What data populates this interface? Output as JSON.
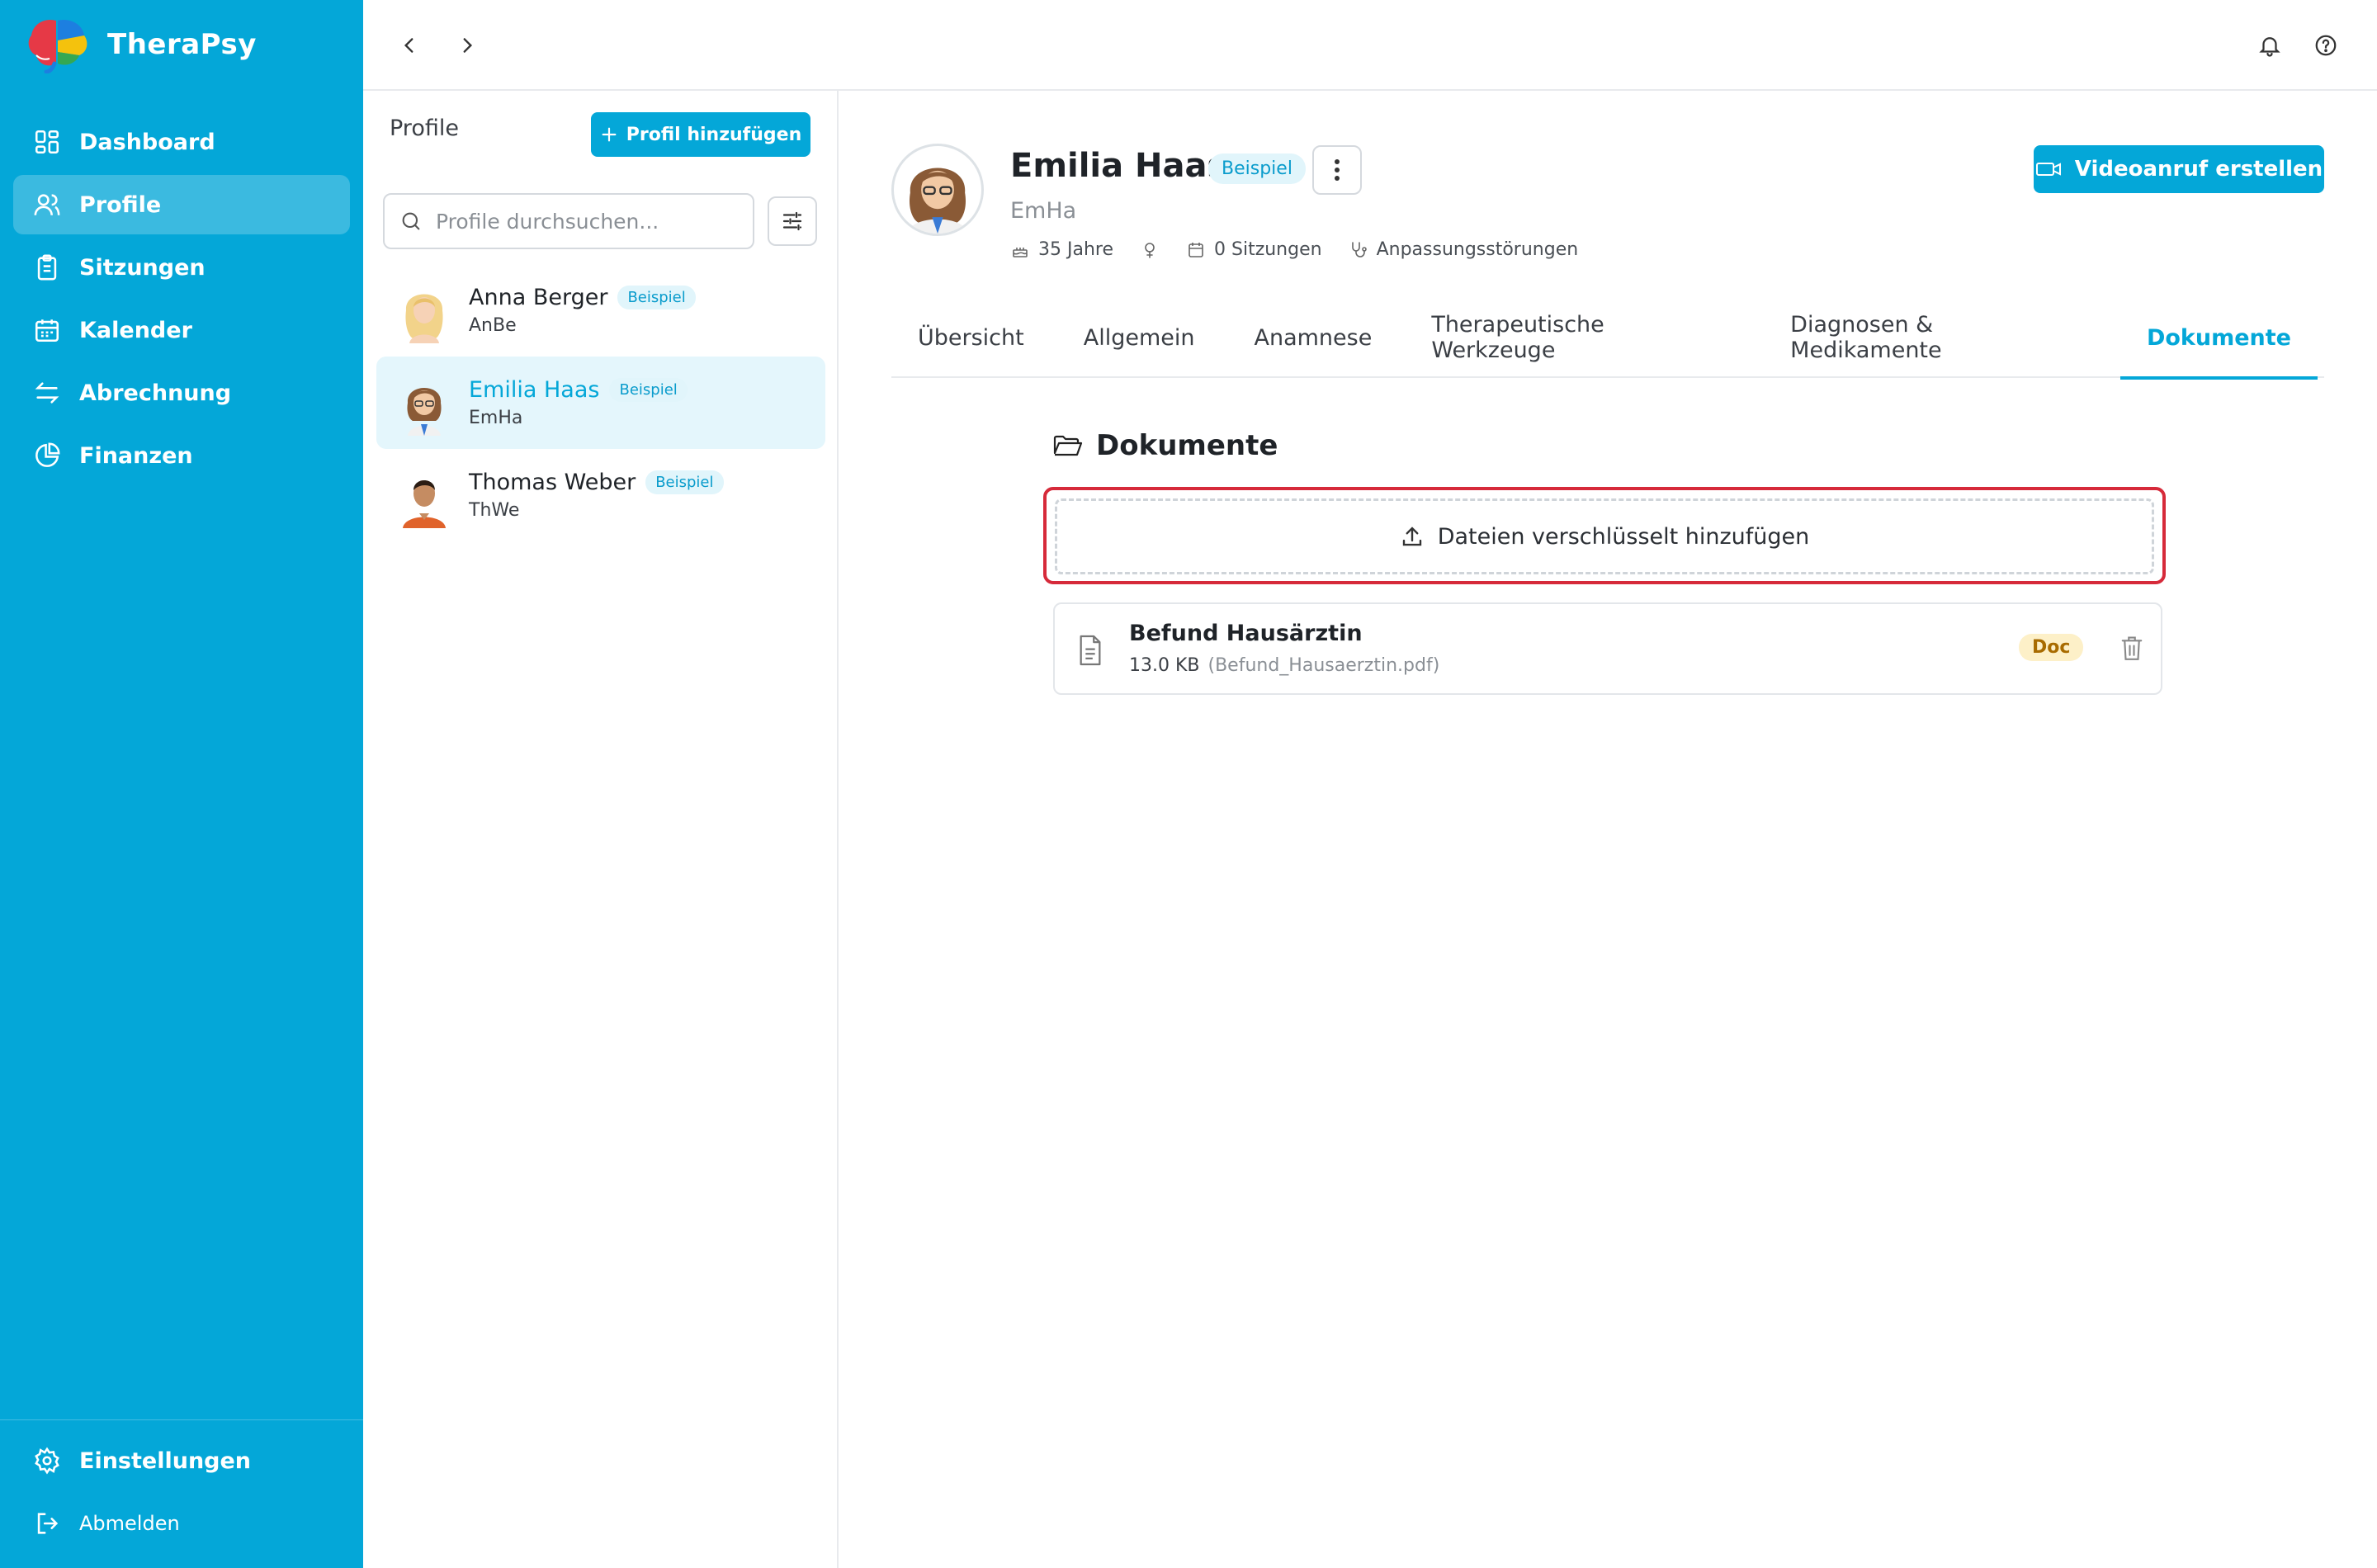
{
  "app": {
    "name": "TheraPsy"
  },
  "sidebar": {
    "items": [
      {
        "label": "Dashboard",
        "icon": "dashboard-icon"
      },
      {
        "label": "Profile",
        "icon": "users-icon",
        "active": true
      },
      {
        "label": "Sitzungen",
        "icon": "clipboard-icon"
      },
      {
        "label": "Kalender",
        "icon": "calendar-icon"
      },
      {
        "label": "Abrechnung",
        "icon": "arrows-exchange-icon"
      },
      {
        "label": "Finanzen",
        "icon": "pie-chart-icon"
      }
    ],
    "settings_label": "Einstellungen",
    "logout_label": "Abmelden"
  },
  "profiles": {
    "title": "Profile",
    "add_label": "Profil hinzufügen",
    "search_placeholder": "Profile durchsuchen...",
    "items": [
      {
        "name": "Anna Berger",
        "short": "AnBe",
        "badge": "Beispiel"
      },
      {
        "name": "Emilia Haas",
        "short": "EmHa",
        "badge": "Beispiel",
        "selected": true
      },
      {
        "name": "Thomas Weber",
        "short": "ThWe",
        "badge": "Beispiel"
      }
    ]
  },
  "profile": {
    "name": "Emilia Haas",
    "badge": "Beispiel",
    "short": "EmHa",
    "age": "35 Jahre",
    "sessions": "0 Sitzungen",
    "diagnosis": "Anpassungsstörungen",
    "video_label": "Videoanruf erstellen"
  },
  "tabs": [
    {
      "label": "Übersicht"
    },
    {
      "label": "Allgemein"
    },
    {
      "label": "Anamnese"
    },
    {
      "label": "Therapeutische Werkzeuge"
    },
    {
      "label": "Diagnosen & Medikamente"
    },
    {
      "label": "Dokumente",
      "active": true
    }
  ],
  "documents": {
    "title": "Dokumente",
    "upload_label": "Dateien verschlüsselt hinzufügen",
    "items": [
      {
        "title": "Befund Hausärztin",
        "size": "13.0 KB",
        "filename": "(Befund_Hausaerztin.pdf)",
        "badge": "Doc"
      }
    ]
  },
  "colors": {
    "accent": "#04a7d8",
    "highlight": "#d62a3a"
  }
}
